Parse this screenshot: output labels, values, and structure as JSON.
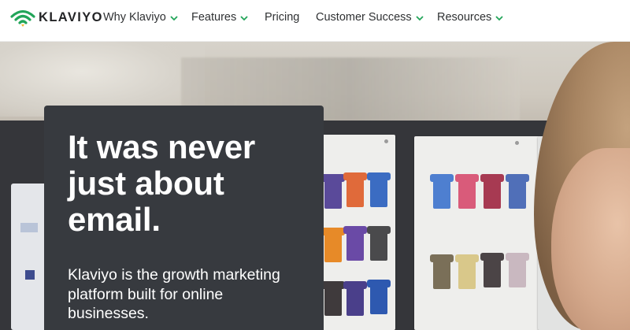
{
  "brand": {
    "name": "KLAVIYO",
    "logo_icon": "signal-wave-icon",
    "accent_color": "#22a559"
  },
  "nav": {
    "items": [
      {
        "label": "Why Klaviyo",
        "has_dropdown": true
      },
      {
        "label": "Features",
        "has_dropdown": true
      },
      {
        "label": "Pricing",
        "has_dropdown": false
      },
      {
        "label": "Customer Success",
        "has_dropdown": true
      },
      {
        "label": "Resources",
        "has_dropdown": true
      }
    ],
    "dropdown_icon": "chevron-down-icon"
  },
  "hero": {
    "title": "It was never just about email.",
    "subtitle": "Klaviyo is the growth marketing platform built for online businesses.",
    "card_color": "#373a3f"
  }
}
